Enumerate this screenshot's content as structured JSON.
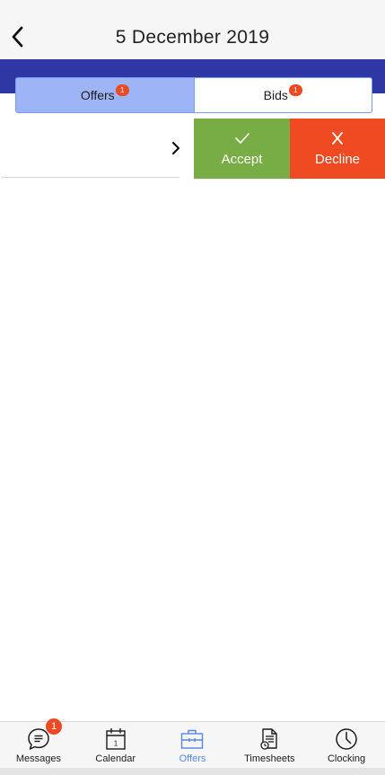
{
  "header": {
    "title": "5 December 2019",
    "back_icon": "chevron-left-icon"
  },
  "segments": [
    {
      "label": "Offers",
      "badge": "1",
      "active": true
    },
    {
      "label": "Bids",
      "badge": "1",
      "active": false
    }
  ],
  "offer_row": {
    "chevron_icon": "chevron-right-icon"
  },
  "actions": {
    "accept": {
      "label": "Accept",
      "icon": "check-icon",
      "color": "#78ad46"
    },
    "decline": {
      "label": "Decline",
      "icon": "close-icon",
      "color": "#f04a23"
    }
  },
  "tabbar": {
    "items": [
      {
        "label": "Messages",
        "icon": "chat-bubble-icon",
        "badge": "1"
      },
      {
        "label": "Calendar",
        "icon": "calendar-icon",
        "day": "1"
      },
      {
        "label": "Offers",
        "icon": "briefcase-icon",
        "active": true
      },
      {
        "label": "Timesheets",
        "icon": "timesheet-icon"
      },
      {
        "label": "Clocking",
        "icon": "clock-icon"
      }
    ]
  },
  "colors": {
    "header_band": "#2e37a3",
    "active_segment": "#9db5f6",
    "active_tab": "#5a86e6",
    "badge": "#ec4a23"
  }
}
